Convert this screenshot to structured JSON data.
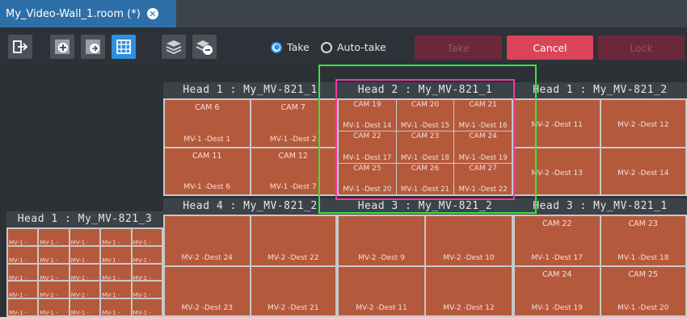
{
  "tab": {
    "title": "My_Video-Wall_1.room (*)",
    "close_glyph": "✕"
  },
  "toolbar": {
    "take_radio": "Take",
    "autotake_radio": "Auto-take",
    "take_button": "Take",
    "cancel_button": "Cancel",
    "lock_button": "Lock"
  },
  "colors": {
    "tile": "#b5593c",
    "accent": "#2f8fe0",
    "cancel": "#d94459",
    "selection_outer": "#39e43b",
    "selection_inner": "#ea3f9a"
  },
  "heads": {
    "h1_top_left": {
      "label": "Head 1 : My_MV-821_1",
      "cells": [
        {
          "cam": "CAM 6",
          "dest": "MV-1 -Dest 1"
        },
        {
          "cam": "CAM 7",
          "dest": "MV-1 -Dest 2"
        },
        {
          "cam": "CAM 11",
          "dest": "MV-1 -Dest 6"
        },
        {
          "cam": "CAM 12",
          "dest": "MV-1 -Dest 7"
        }
      ]
    },
    "h2_top_center": {
      "label": "Head 2 : My_MV-821_1",
      "cells": [
        {
          "cam": "CAM 19",
          "dest": "MV-1 -Dest 14"
        },
        {
          "cam": "CAM 20",
          "dest": "MV-1 -Dest 15"
        },
        {
          "cam": "CAM 21",
          "dest": "MV-1 -Dest 16"
        },
        {
          "cam": "CAM 22",
          "dest": "MV-1 -Dest 17"
        },
        {
          "cam": "CAM 23",
          "dest": "MV-1 -Dest 18"
        },
        {
          "cam": "CAM 24",
          "dest": "MV-1 -Dest 19"
        },
        {
          "cam": "CAM 25",
          "dest": "MV-1 -Dest 20"
        },
        {
          "cam": "CAM 26",
          "dest": "MV-1 -Dest 21"
        },
        {
          "cam": "CAM 27",
          "dest": "MV-1 -Dest 22"
        }
      ]
    },
    "h1_top_right": {
      "label": "Head 1 : My_MV-821_2",
      "cells": [
        {
          "cam": "",
          "dest": "MV-2 -Dest 11"
        },
        {
          "cam": "",
          "dest": "MV-2 -Dest 12"
        },
        {
          "cam": "",
          "dest": "MV-2 -Dest 13"
        },
        {
          "cam": "",
          "dest": "MV-2 -Dest 14"
        }
      ]
    },
    "h1_left": {
      "label": "Head 1 : My_MV-821_3",
      "mini_text": "MV-1 -"
    },
    "h4_bottom_left": {
      "label": "Head 4 : My_MV-821_2",
      "cells": [
        {
          "cam": "",
          "dest": "MV-2 -Dest 24"
        },
        {
          "cam": "",
          "dest": "MV-2 -Dest 22"
        },
        {
          "cam": "",
          "dest": "MV-2 -Dest 23"
        },
        {
          "cam": "",
          "dest": "MV-2 -Dest 21"
        }
      ]
    },
    "h3_bottom_center": {
      "label": "Head 3 : My_MV-821_2",
      "cells": [
        {
          "cam": "",
          "dest": "MV-2 -Dest 9"
        },
        {
          "cam": "",
          "dest": "MV-2 -Dest 10"
        },
        {
          "cam": "",
          "dest": "MV-2 -Dest 11"
        },
        {
          "cam": "",
          "dest": "MV-2 -Dest 12"
        }
      ]
    },
    "h3_bottom_right": {
      "label": "Head 3 : My_MV-821_1",
      "cells": [
        {
          "cam": "CAM 22",
          "dest": "MV-1 -Dest 17"
        },
        {
          "cam": "CAM 23",
          "dest": "MV-1 -Dest 18"
        },
        {
          "cam": "CAM 24",
          "dest": "MV-1 -Dest 19"
        },
        {
          "cam": "CAM 25",
          "dest": "MV-1 -Dest 20"
        }
      ]
    }
  }
}
